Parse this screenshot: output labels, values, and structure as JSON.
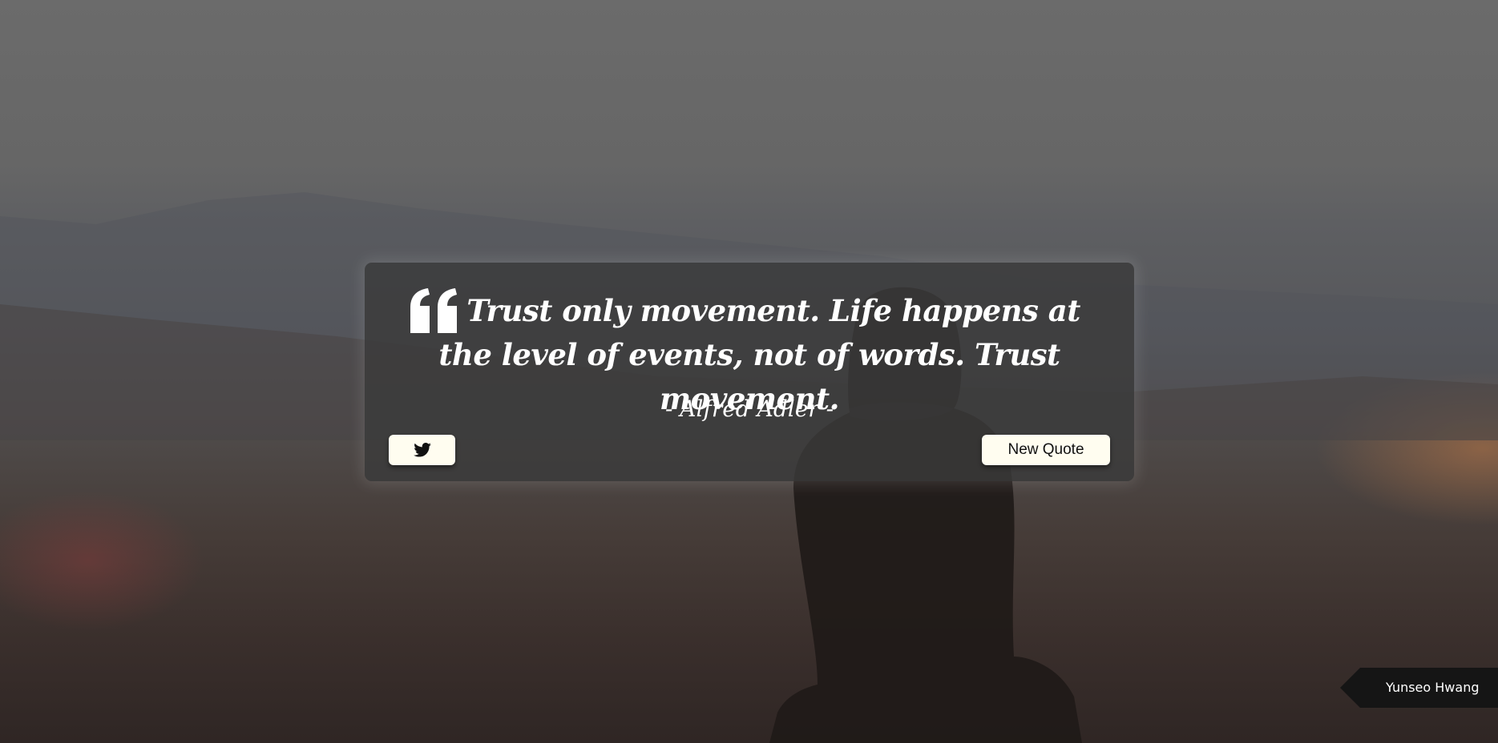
{
  "quote": {
    "text": "Trust only movement. Life happens at the level of events, not of words. Trust movement.",
    "author": "- Alfred Adler -",
    "icon": "quote-left-icon"
  },
  "actions": {
    "tweet_icon": "twitter-icon",
    "new_quote_label": "New Quote"
  },
  "credit": {
    "name": "Yunseo Hwang"
  },
  "colors": {
    "card_bg": "#3a3a3a",
    "button_bg": "#fffdf0",
    "text": "#ffffff",
    "credit_bg": "#151515"
  }
}
